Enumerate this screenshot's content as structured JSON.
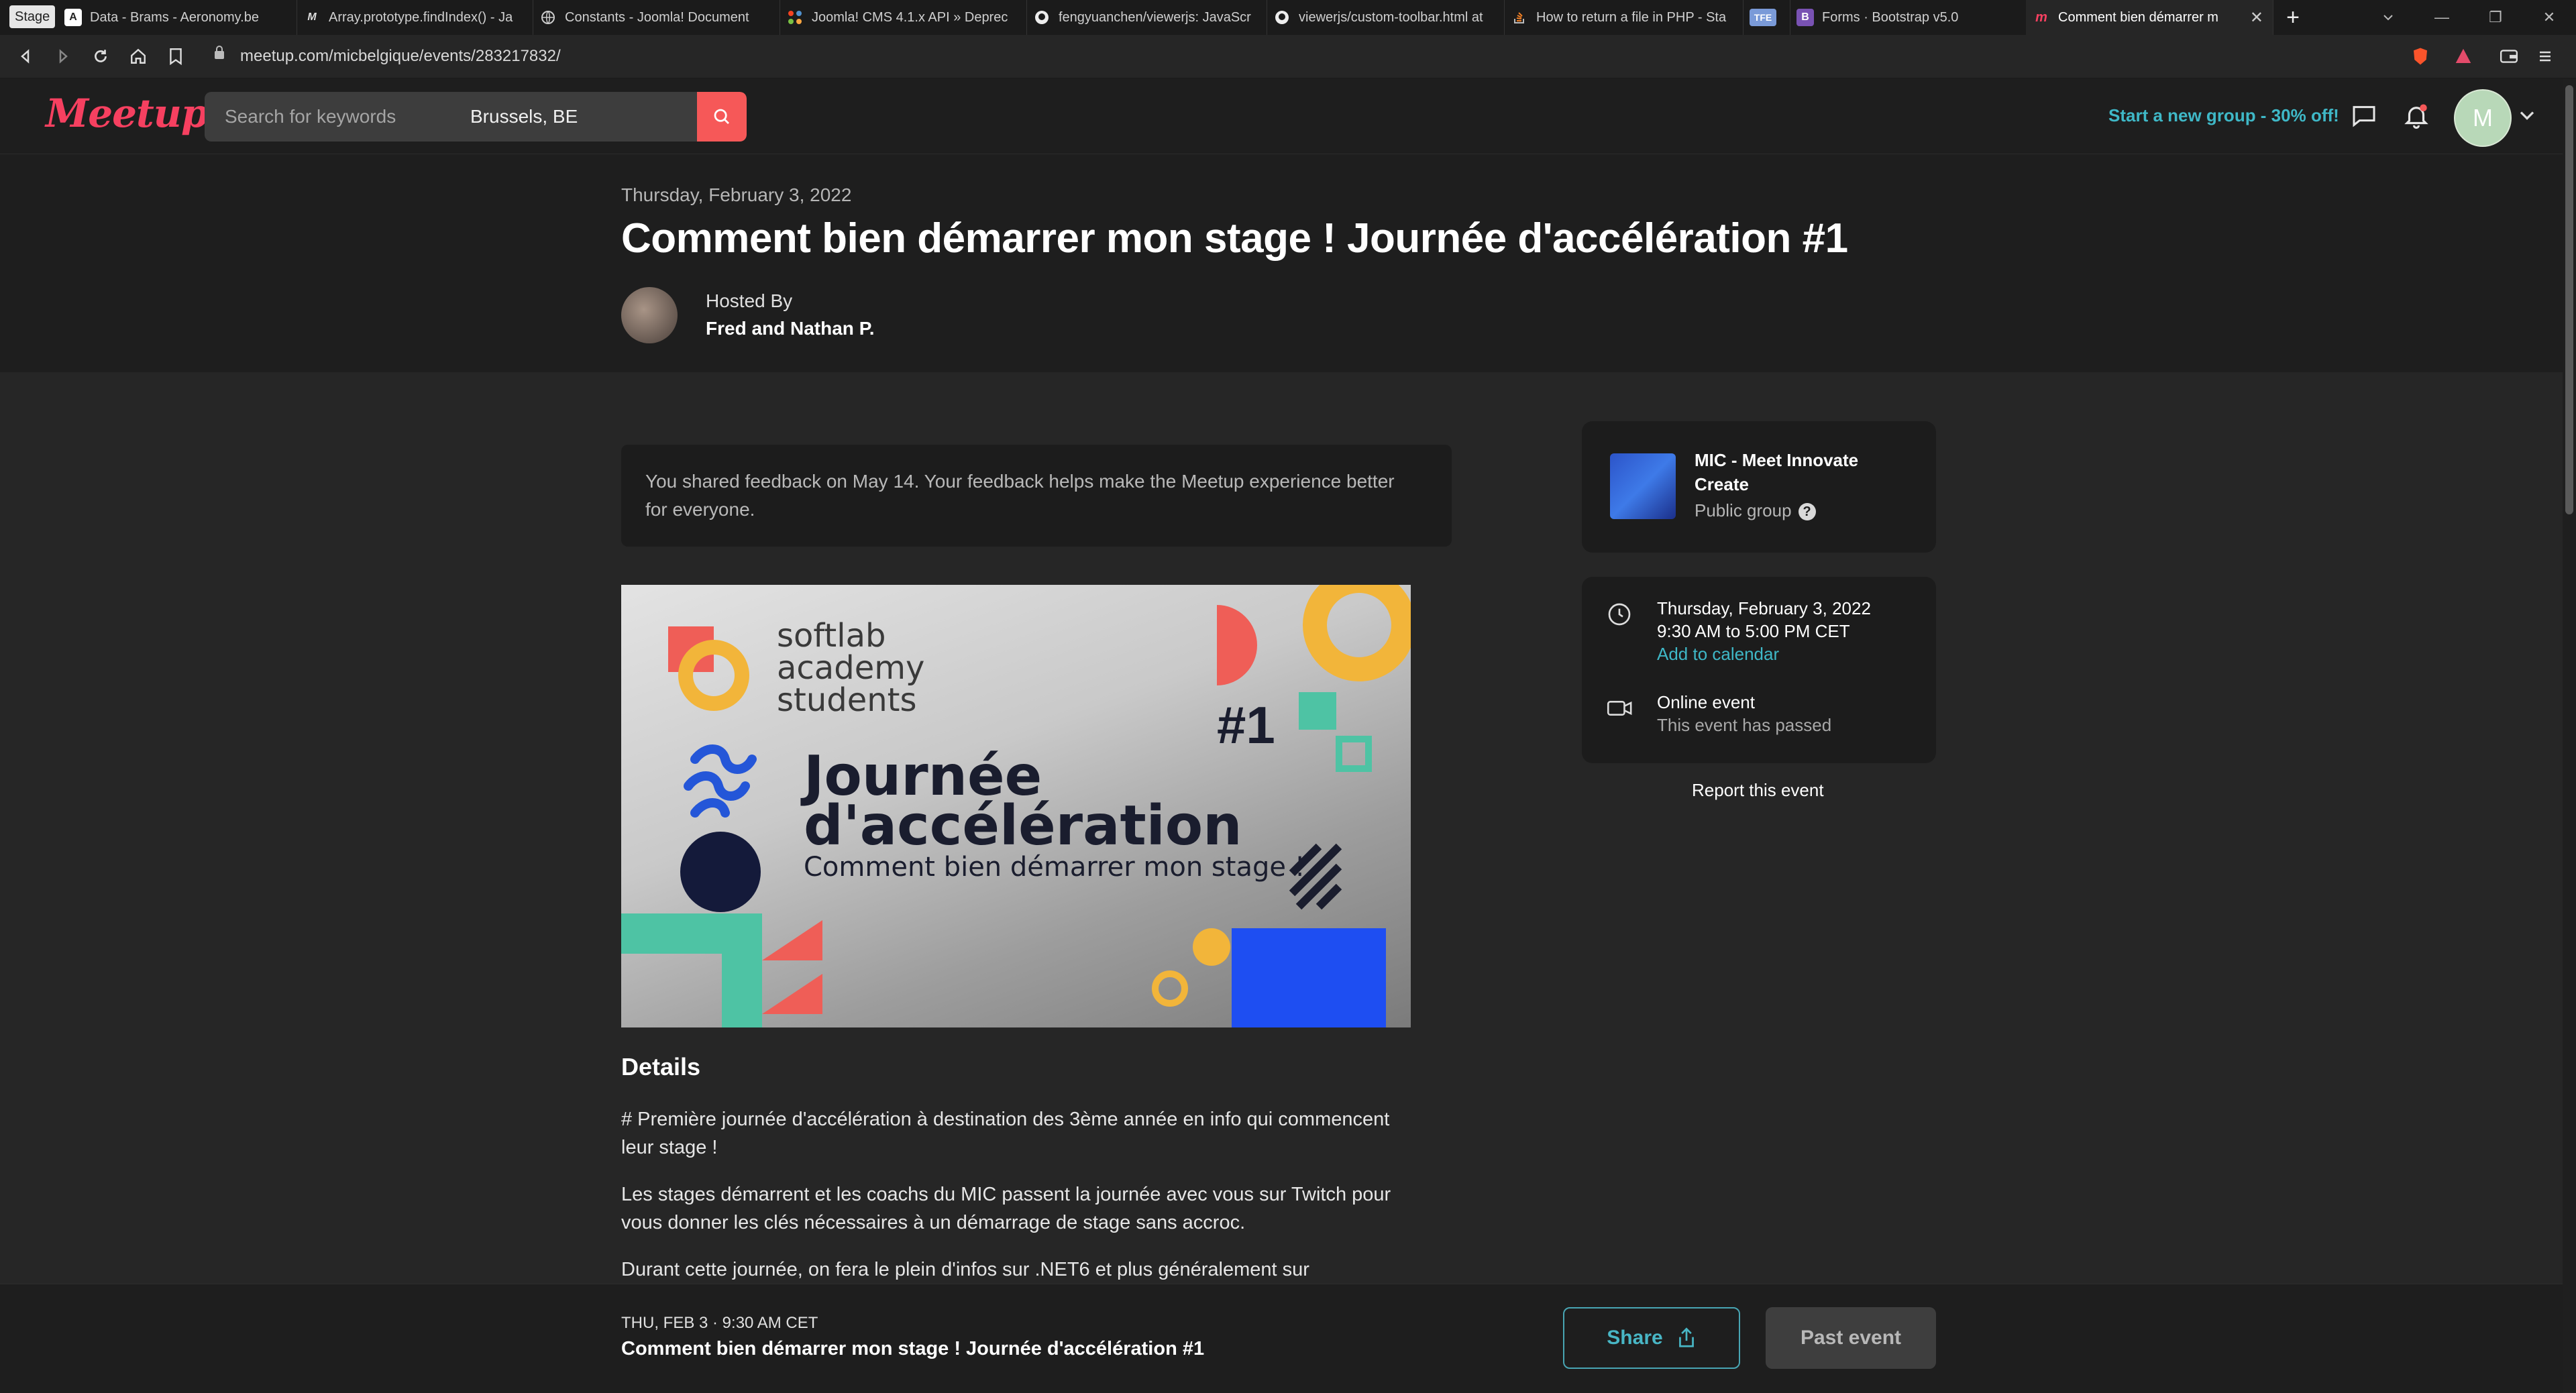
{
  "browser": {
    "stage_label": "Stage",
    "tabs": [
      {
        "label": "Data - Brams - Aeronomy.be",
        "icon": "aeronomy-icon"
      },
      {
        "label": "Array.prototype.findIndex() - Ja",
        "icon": "mdn-icon"
      },
      {
        "label": "Constants - Joomla! Document",
        "icon": "globe-icon"
      },
      {
        "label": "Joomla! CMS 4.1.x API » Deprec",
        "icon": "joomla-icon"
      },
      {
        "label": "fengyuanchen/viewerjs: JavaScr",
        "icon": "github-icon"
      },
      {
        "label": "viewerjs/custom-toolbar.html at",
        "icon": "github-icon"
      },
      {
        "label": "How to return a file in PHP - Sta",
        "icon": "stackoverflow-icon"
      },
      {
        "label": "TFE",
        "icon": "tfe-icon"
      },
      {
        "label": "Forms · Bootstrap v5.0",
        "icon": "bootstrap-icon"
      },
      {
        "label": "Comment bien démarrer m",
        "icon": "meetup-icon"
      }
    ],
    "url": "meetup.com/micbelgique/events/283217832/"
  },
  "header": {
    "logo": "Meetup",
    "search_placeholder": "Search for keywords",
    "location": "Brussels, BE",
    "promo": "Start a new group - 30% off!",
    "avatar_initial": "M"
  },
  "event": {
    "date": "Thursday, February 3, 2022",
    "title": "Comment bien démarrer mon stage ! Journée d'accélération #1",
    "hosted_by_label": "Hosted By",
    "hosts": "Fred and Nathan P."
  },
  "feedback": {
    "text": "You shared feedback on May 14. Your feedback helps make the Meetup experience better for everyone."
  },
  "banner": {
    "brand_line1": "softlab",
    "brand_line2": "academy",
    "brand_line3": "students",
    "number": "#1",
    "heading_line1": "Journée",
    "heading_line2": "d'accélération",
    "subheading": "Comment bien démarrer mon stage !"
  },
  "details": {
    "heading": "Details",
    "paragraphs": [
      "# Première journée d'accélération à destination des 3ème année en info qui commencent leur stage !",
      "Les stages démarrent et les coachs du MIC passent la journée avec vous sur Twitch pour vous donner les clés nécessaires à un démarrage de stage sans accroc.",
      "Durant cette journée, on fera le plein d'infos sur .NET6 et plus généralement sur"
    ]
  },
  "group": {
    "name": "MIC - Meet Innovate Create",
    "type": "Public group"
  },
  "info": {
    "date": "Thursday, February 3, 2022",
    "time": "9:30 AM to 5:00 PM CET",
    "add_calendar": "Add to calendar",
    "location_type": "Online event",
    "status": "This event has passed",
    "report": "Report this event"
  },
  "footer": {
    "date": "THU, FEB 3 · 9:30 AM CET",
    "title": "Comment bien démarrer mon stage ! Journée d'accélération #1",
    "share": "Share",
    "past": "Past event"
  },
  "colors": {
    "brand": "#f64060",
    "accent": "#3fb8c7",
    "search_button": "#f65858"
  }
}
